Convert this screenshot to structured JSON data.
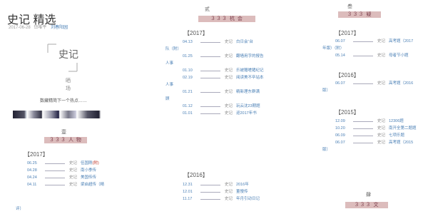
{
  "header": {
    "title": "史记 精选",
    "date": "2017-06-28",
    "author": "岱唯平",
    "link": "刘春阳园"
  },
  "logo": {
    "big": "史记",
    "small": "晒 场"
  },
  "tagline": "数藏精简下一个热点……",
  "col1": {
    "num": "壹",
    "banner": "３３３ 人 物",
    "year": "【2017】",
    "rows": [
      {
        "d": "06.25",
        "s": "史记",
        "t": "伍国刚",
        "r": "(附)"
      },
      {
        "d": "04.28",
        "s": "史记",
        "t": "南小季传"
      },
      {
        "d": "04.24",
        "s": "史记",
        "t": "美国传传"
      },
      {
        "d": "04.11",
        "s": "史记",
        "t": "梁启超传（精"
      }
    ],
    "tail": "评）"
  },
  "col2": {
    "num": "贰",
    "banner": "３３３ 杭 会",
    "year1": "【2017】",
    "year2": "【2016】",
    "rows": [
      {
        "d": "04.13",
        "s": "史记",
        "t": "白日会“台"
      },
      {
        "cat": "队（附）"
      },
      {
        "d": "01.25",
        "s": "史记",
        "t": "翻墙用字的报告"
      },
      {
        "cat": "人事"
      },
      {
        "d": "01.10",
        "s": "史记",
        "t": "乐被赠嗟猪纪记"
      },
      {
        "d": "02.19",
        "s": "史记",
        "t": "阅读美不卒站本"
      },
      {
        "cat": "人事"
      },
      {
        "d": "01.21",
        "s": "史记",
        "t": "精新理东群满"
      },
      {
        "cat": "顾"
      },
      {
        "d": "01.12",
        "s": "史记",
        "t": "玩云沈23期题"
      },
      {
        "d": "01.01",
        "s": "史记",
        "t": "迎2017年书"
      }
    ],
    "rows2": [
      {
        "d": "12.31",
        "s": "史记",
        "t": "2016年"
      },
      {
        "d": "12.01",
        "s": "史记",
        "t": "董慢传"
      },
      {
        "d": "11.17",
        "s": "史记",
        "t": "年月引动日记"
      }
    ]
  },
  "col3": {
    "num": "叁",
    "banner": "３３３ 疑",
    "num2": "肆",
    "banner2": "３３３ 文",
    "y2017": "【2017】",
    "y2016": "【2016】",
    "y2015": "【2015】",
    "rows2017": [
      {
        "d": "06.07",
        "s": "史记",
        "t": "高考题（2017"
      },
      {
        "cat": "年版）（附）"
      },
      {
        "d": "05.14",
        "s": "史记",
        "t": "母者节小题"
      }
    ],
    "rows2016": [
      {
        "d": "06.07",
        "s": "史记",
        "t": "高考题（2016"
      },
      {
        "cat": "版）"
      }
    ],
    "rows2015": [
      {
        "d": "12.09",
        "s": "史记",
        "t": "12306题"
      },
      {
        "d": "10.20",
        "s": "史记",
        "t": "南开全第二题题"
      },
      {
        "d": "06.09",
        "s": "史记",
        "t": "七项乐题"
      },
      {
        "d": "06.07",
        "s": "史记",
        "t": "高考题（2015"
      },
      {
        "cat": "版）"
      }
    ]
  }
}
